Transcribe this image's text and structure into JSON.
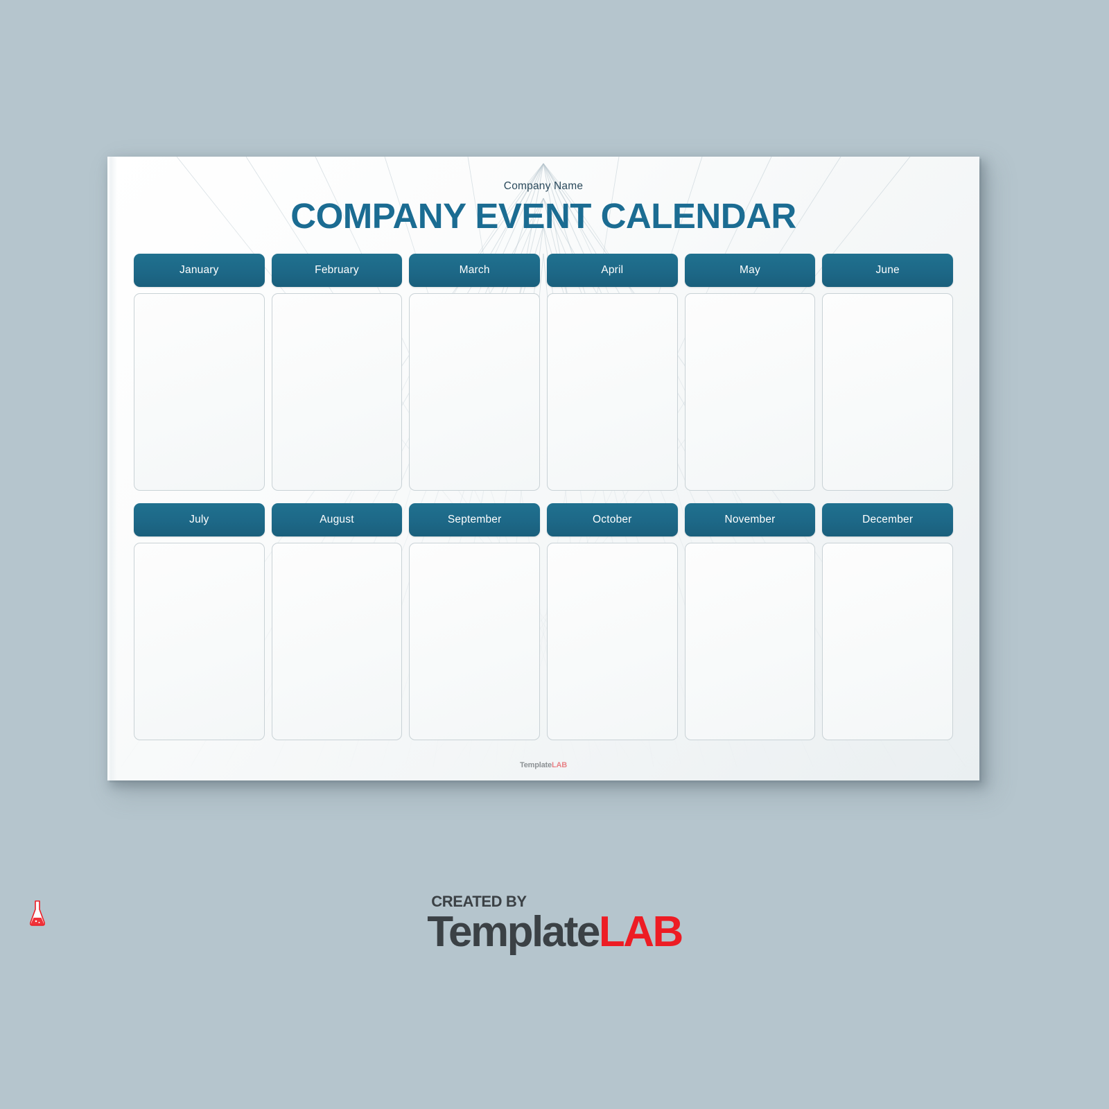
{
  "page": {
    "company_name": "Company Name",
    "title": "COMPANY EVENT CALENDAR",
    "footer_brand_a": "Template",
    "footer_brand_b": "LAB"
  },
  "calendar": {
    "rows": [
      {
        "months": [
          "January",
          "February",
          "March",
          "April",
          "May",
          "June"
        ]
      },
      {
        "months": [
          "July",
          "August",
          "September",
          "October",
          "November",
          "December"
        ]
      }
    ]
  },
  "watermark": {
    "created_by": "CREATED BY",
    "brand_a": "Template",
    "brand_b": "LAB"
  },
  "colors": {
    "canvas": "#b5c5cd",
    "accent_blue": "#1d6887",
    "title_blue": "#1b6c92",
    "brand_red": "#ed1c24",
    "brand_dark": "#3b4145",
    "cell_border": "#c9d2d6"
  }
}
